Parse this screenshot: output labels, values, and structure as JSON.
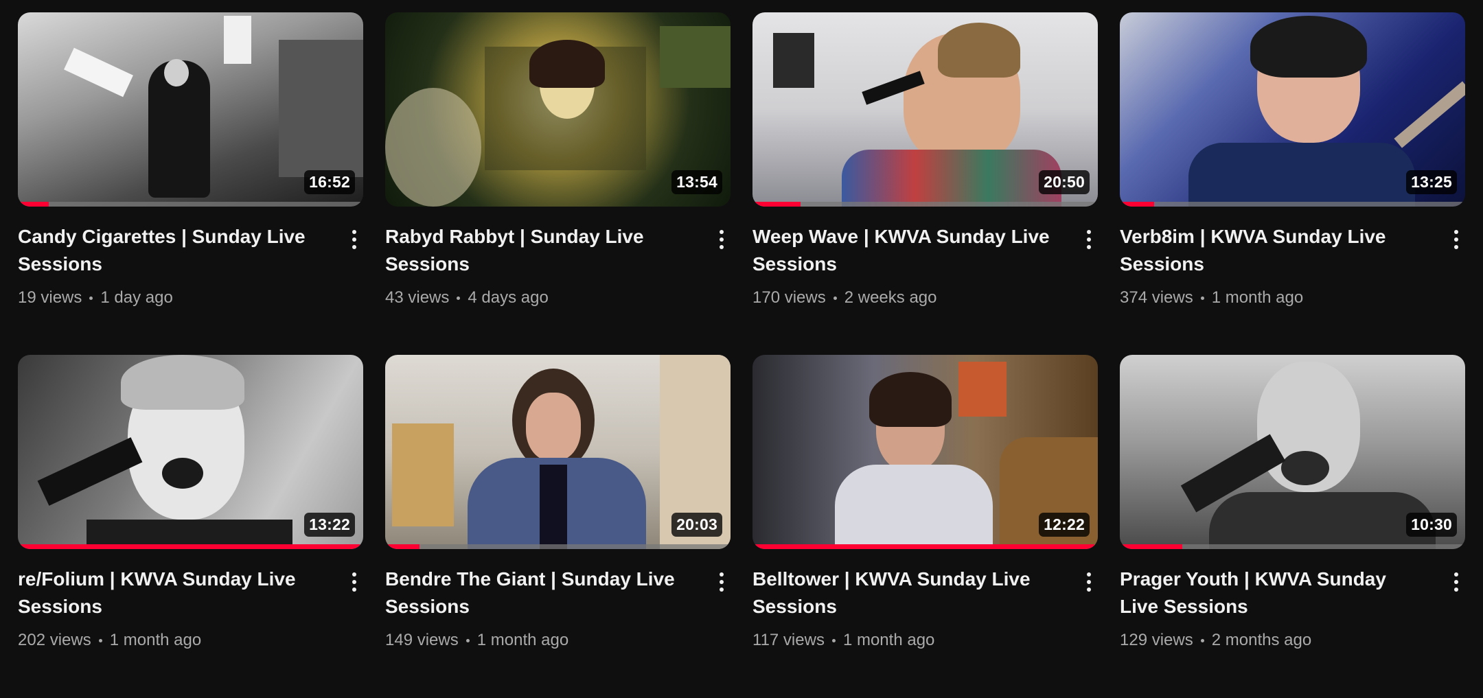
{
  "videos": [
    {
      "title": "Candy Cigarettes | Sunday Live Sessions",
      "views": "19 views",
      "age": "1 day ago",
      "duration": "16:52",
      "progress": 0.09,
      "bg": "#8a8a8a"
    },
    {
      "title": "Rabyd Rabbyt | Sunday Live Sessions",
      "views": "43 views",
      "age": "4 days ago",
      "duration": "13:54",
      "progress": 0.0,
      "bg": "#1e2a14"
    },
    {
      "title": "Weep Wave | KWVA Sunday Live Sessions",
      "views": "170 views",
      "age": "2 weeks ago",
      "duration": "20:50",
      "progress": 0.14,
      "bg": "#c9c9cc"
    },
    {
      "title": "Verb8im | KWVA Sunday Live Sessions",
      "views": "374 views",
      "age": "1 month ago",
      "duration": "13:25",
      "progress": 0.1,
      "bg": "#1d2a86"
    },
    {
      "title": "re/Folium | KWVA Sunday Live Sessions",
      "views": "202 views",
      "age": "1 month ago",
      "duration": "13:22",
      "progress": 0.99,
      "bg": "#6e6e6e"
    },
    {
      "title": "Bendre The Giant | Sunday Live Sessions",
      "views": "149 views",
      "age": "1 month ago",
      "duration": "20:03",
      "progress": 0.1,
      "bg": "#bdb8b0"
    },
    {
      "title": "Belltower | KWVA Sunday Live Sessions",
      "views": "117 views",
      "age": "1 month ago",
      "duration": "12:22",
      "progress": 0.99,
      "bg": "#6a5a4a"
    },
    {
      "title": "Prager Youth | KWVA Sunday Live Sessions",
      "views": "129 views",
      "age": "2 months ago",
      "duration": "10:30",
      "progress": 0.18,
      "bg": "#7b7b7b"
    }
  ],
  "colors": {
    "page_bg": "#0f0f0f",
    "progress": "#ff0033",
    "title": "#f1f1f1",
    "meta": "#aaaaaa"
  },
  "icons": {
    "menu": "more-vert-icon"
  }
}
